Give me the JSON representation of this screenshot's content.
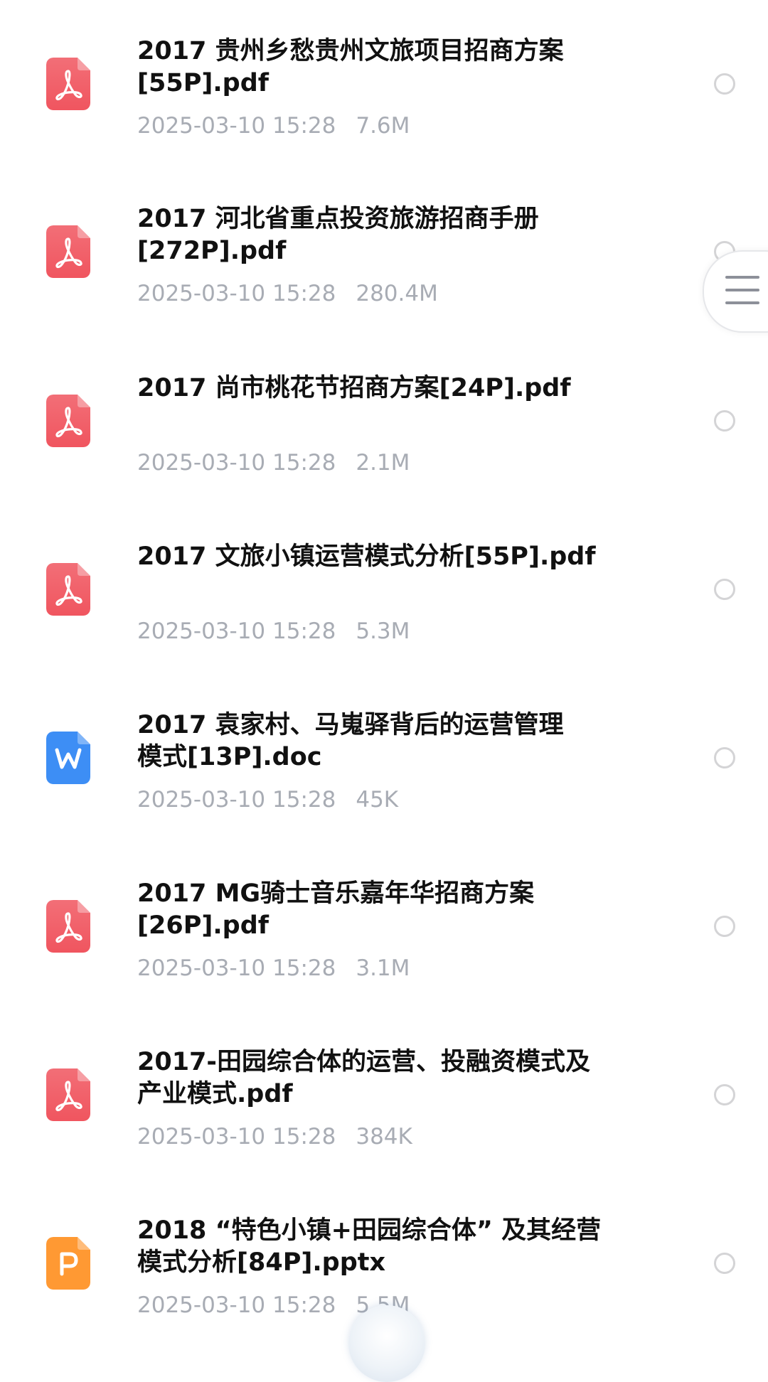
{
  "files": [
    {
      "name": "2017 贵州乡愁贵州文旅项目招商方案\n[55P].pdf",
      "date": "2025-03-10 15:28",
      "size": "7.6M",
      "type": "pdf",
      "icon": "pdf-icon"
    },
    {
      "name": "2017 河北省重点投资旅游招商手册\n[272P].pdf",
      "date": "2025-03-10 15:28",
      "size": "280.4M",
      "type": "pdf",
      "icon": "pdf-icon"
    },
    {
      "name": "2017 尚市桃花节招商方案[24P].pdf",
      "date": "2025-03-10 15:28",
      "size": "2.1M",
      "type": "pdf",
      "icon": "pdf-icon"
    },
    {
      "name": "2017 文旅小镇运营模式分析[55P].pdf",
      "date": "2025-03-10 15:28",
      "size": "5.3M",
      "type": "pdf",
      "icon": "pdf-icon"
    },
    {
      "name": "2017 袁家村、马嵬驿背后的运营管理\n模式[13P].doc",
      "date": "2025-03-10 15:28",
      "size": "45K",
      "type": "doc",
      "icon": "word-icon"
    },
    {
      "name": "2017 MG骑士音乐嘉年华招商方案\n[26P].pdf",
      "date": "2025-03-10 15:28",
      "size": "3.1M",
      "type": "pdf",
      "icon": "pdf-icon"
    },
    {
      "name": "2017-田园综合体的运营、投融资模式及\n产业模式.pdf",
      "date": "2025-03-10 15:28",
      "size": "384K",
      "type": "pdf",
      "icon": "pdf-icon"
    },
    {
      "name": "2018 “特色小镇+田园综合体” 及其经营\n模式分析[84P].pptx",
      "date": "2025-03-10 15:28",
      "size": "5.5M",
      "type": "pptx",
      "icon": "powerpoint-icon"
    }
  ],
  "colors": {
    "pdf": "#f0555f",
    "doc": "#3d8ef5",
    "pptx": "#ff9933",
    "meta_text": "#a8acb4",
    "radio_border": "#d4d4d6"
  },
  "side_menu": {
    "icon": "hamburger-menu-icon"
  }
}
